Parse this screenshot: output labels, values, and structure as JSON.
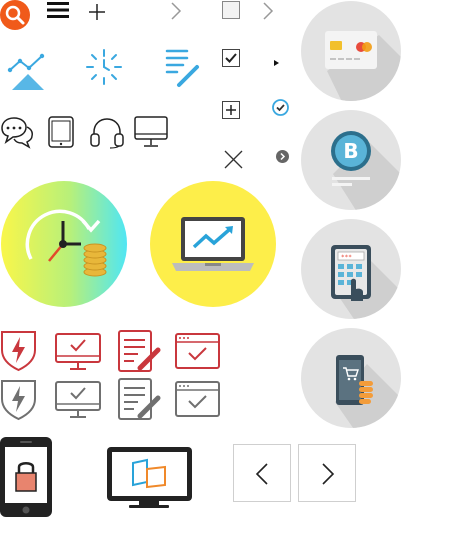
{
  "sheet": {
    "icons": [
      "search-icon",
      "menu-icon",
      "plus-icon",
      "chevron-right-icon",
      "checkbox-empty-icon",
      "line-chart-icon",
      "clock-sun-icon",
      "document-pencil-icon",
      "checkbox-checked-icon",
      "small-triangle-icon",
      "plus-box-icon",
      "check-circle-icon",
      "close-icon",
      "chevron-right-circle-icon",
      "chat-icon",
      "tablet-icon",
      "headset-icon",
      "monitor-icon",
      "time-money-icon",
      "laptop-chart-icon",
      "credit-card-icon",
      "bitcoin-icon",
      "calculator-icon",
      "mobile-shopping-icon",
      "shield-lightning-icon",
      "monitor-check-icon",
      "document-edit-icon",
      "browser-check-icon",
      "phone-lock-icon",
      "monitor-window-icon",
      "arrow-left-icon",
      "arrow-right-icon"
    ],
    "colors": {
      "accent_orange": "#f05a1a",
      "cyan_blue": "#3aa8e0",
      "red_line": "#c9373d",
      "gray_line": "#707070",
      "yellow": "#fdee4a",
      "circle_gray": "#e3e3e3"
    }
  },
  "calculator": {
    "display": "***"
  }
}
